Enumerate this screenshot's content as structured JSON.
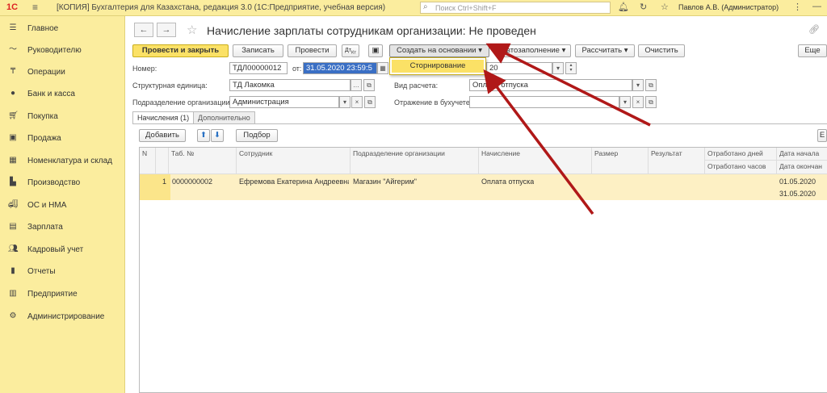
{
  "app": {
    "logo": "1С",
    "title": "[КОПИЯ] Бухгалтерия для Казахстана, редакция 3.0  (1С:Предприятие, учебная версия)",
    "search_placeholder": "Поиск Ctrl+Shift+F",
    "user": "Павлов А.В. (Администратор)"
  },
  "sidebar": {
    "items": [
      {
        "label": "Главное",
        "icon": "menu-icon"
      },
      {
        "label": "Руководителю",
        "icon": "trend-icon"
      },
      {
        "label": "Операции",
        "icon": "operations-icon"
      },
      {
        "label": "Банк и касса",
        "icon": "bank-icon"
      },
      {
        "label": "Покупка",
        "icon": "cart-icon"
      },
      {
        "label": "Продажа",
        "icon": "bag-icon"
      },
      {
        "label": "Номенклатура и склад",
        "icon": "warehouse-icon"
      },
      {
        "label": "Производство",
        "icon": "factory-icon"
      },
      {
        "label": "ОС и НМА",
        "icon": "truck-icon"
      },
      {
        "label": "Зарплата",
        "icon": "salary-icon"
      },
      {
        "label": "Кадровый учет",
        "icon": "people-icon"
      },
      {
        "label": "Отчеты",
        "icon": "reports-icon"
      },
      {
        "label": "Предприятие",
        "icon": "enterprise-icon"
      },
      {
        "label": "Администрирование",
        "icon": "gear-icon"
      }
    ]
  },
  "document": {
    "title": "Начисление зарплаты сотрудникам организации: Не проведен"
  },
  "toolbar": {
    "post_close": "Провести и закрыть",
    "save": "Записать",
    "post": "Провести",
    "create_based": "Создать на основании",
    "autofill": "Автозаполнение",
    "calculate": "Рассчитать",
    "clear": "Очистить",
    "more": "Еще"
  },
  "dropdown": {
    "item": "Сторнирование"
  },
  "form": {
    "number_label": "Номер:",
    "number_value": "ТДЛ00000012",
    "date_label": "от:",
    "date_value": "31.05.2020 23:59:5",
    "period_value": "20",
    "unit_label": "Структурная единица:",
    "unit_value": "ТД Лакомка",
    "calc_type_label": "Вид расчета:",
    "calc_type_value": "Оплата отпуска",
    "department_label": "Подразделение организации:",
    "department_value": "Администрация",
    "accounting_label": "Отражение в бухучете:",
    "accounting_value": ""
  },
  "tabs": {
    "accruals": "Начисления (1)",
    "additional": "Дополнительно"
  },
  "table_toolbar": {
    "add": "Добавить",
    "select": "Подбор",
    "more": "Е"
  },
  "table": {
    "headers": {
      "n": "N",
      "tab_no": "Таб. №",
      "employee": "Сотрудник",
      "department": "Подразделение организации",
      "accrual": "Начисление",
      "amount": "Размер",
      "result": "Результат",
      "days": "Отработано дней",
      "hours": "Отработано часов",
      "date_start": "Дата начала",
      "date_end": "Дата окончан"
    },
    "rows": [
      {
        "n": "1",
        "tab_no": "0000000002",
        "employee": "Ефремова Екатерина Андреевна",
        "department": "Магазин \"Айгерим\"",
        "accrual": "Оплата отпуска",
        "date_start": "01.05.2020",
        "date_end": "31.05.2020"
      }
    ]
  }
}
